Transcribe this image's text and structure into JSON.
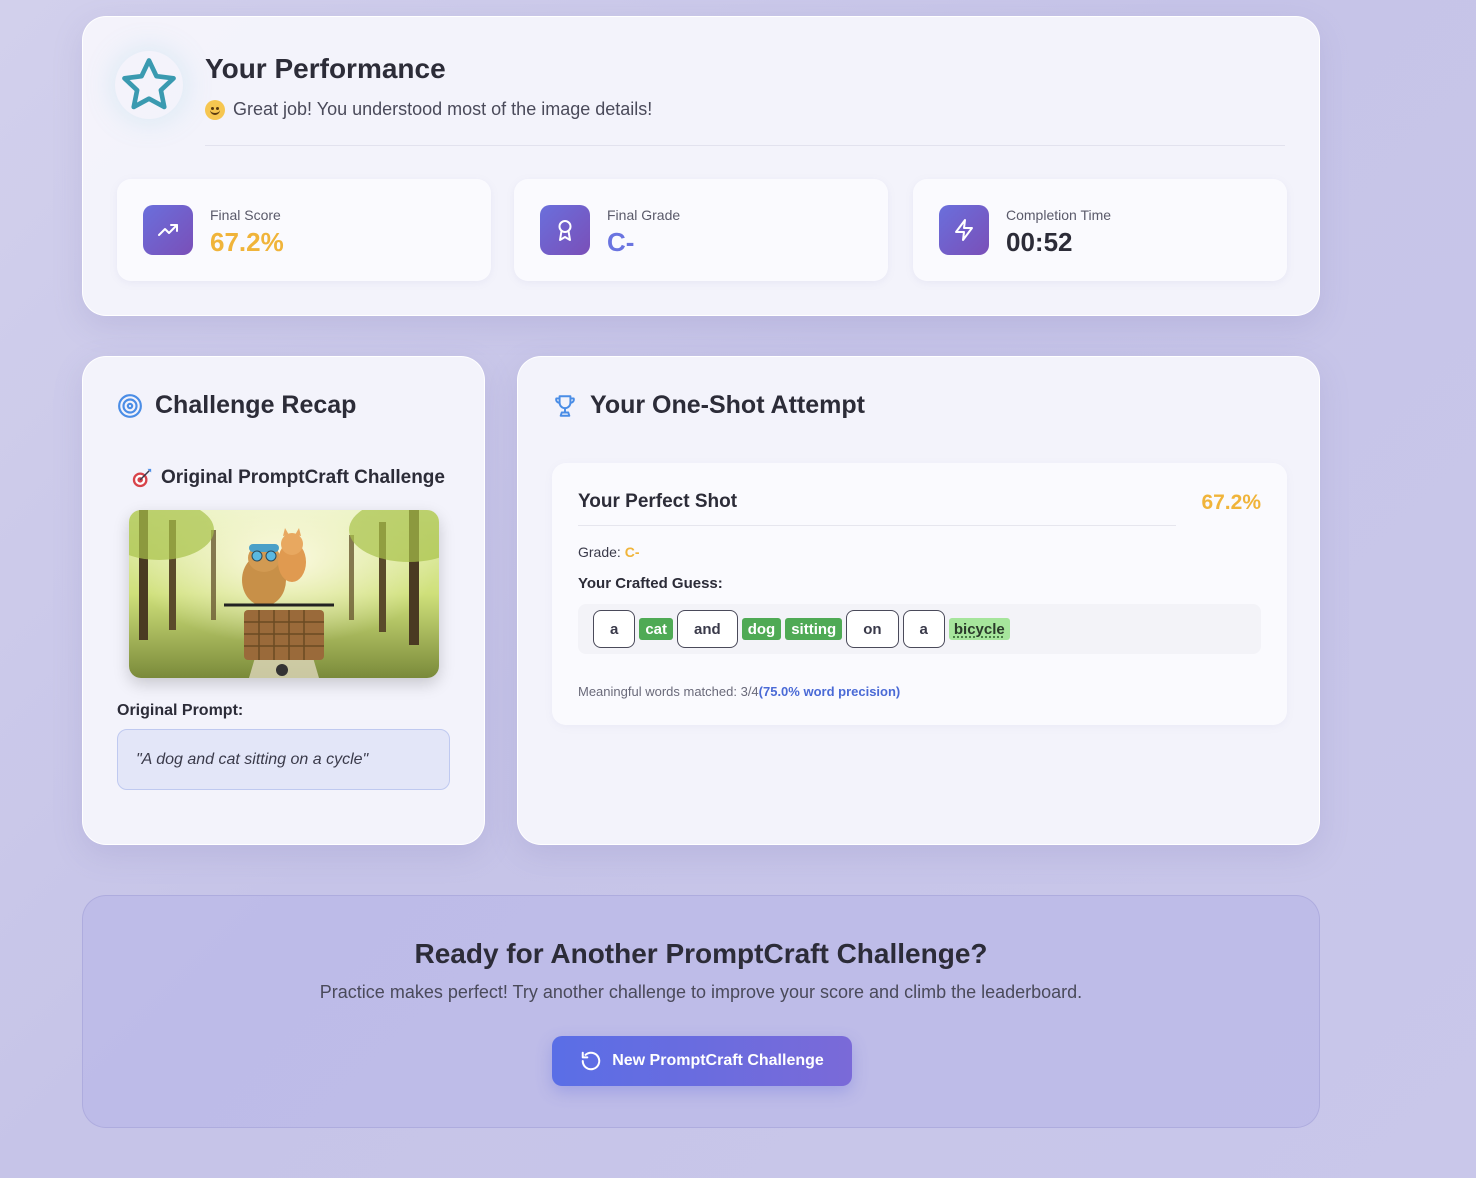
{
  "performance": {
    "title": "Your Performance",
    "subtitle": "Great job! You understood most of the image details!",
    "stats": [
      {
        "label": "Final Score",
        "value": "67.2%",
        "color": "#f0b43a",
        "icon": "trending-up-icon"
      },
      {
        "label": "Final Grade",
        "value": "C-",
        "color": "#6a74e0",
        "icon": "award-icon"
      },
      {
        "label": "Completion Time",
        "value": "00:52",
        "color": "#2c2c38",
        "icon": "zap-icon"
      }
    ]
  },
  "recap": {
    "title": "Challenge Recap",
    "original_title": "Original PromptCraft Challenge",
    "prompt_label": "Original Prompt:",
    "prompt_text": "\"A dog and cat sitting on a cycle\""
  },
  "attempt": {
    "title": "Your One-Shot Attempt",
    "shot_title": "Your Perfect Shot",
    "score": "67.2%",
    "grade_label": "Grade:",
    "grade_value": "C-",
    "guess_label": "Your Crafted Guess:",
    "words": [
      {
        "text": "a",
        "status": "plain"
      },
      {
        "text": "cat",
        "status": "hit"
      },
      {
        "text": "and",
        "status": "plain"
      },
      {
        "text": "dog",
        "status": "hit"
      },
      {
        "text": "sitting",
        "status": "hit"
      },
      {
        "text": "on",
        "status": "plain"
      },
      {
        "text": "a",
        "status": "plain"
      },
      {
        "text": "bicycle",
        "status": "syn"
      }
    ],
    "match_text": "Meaningful words matched: 3/4",
    "precision_text": "(75.0% word precision)"
  },
  "cta": {
    "title": "Ready for Another PromptCraft Challenge?",
    "subtitle": "Practice makes perfect! Try another challenge to improve your score and climb the leaderboard.",
    "button_label": "New PromptCraft Challenge"
  },
  "colors": {
    "accent": "#6a6fdc",
    "score": "#f0b43a",
    "match_green": "#4faa55",
    "synonym_green": "#a6e59c"
  }
}
